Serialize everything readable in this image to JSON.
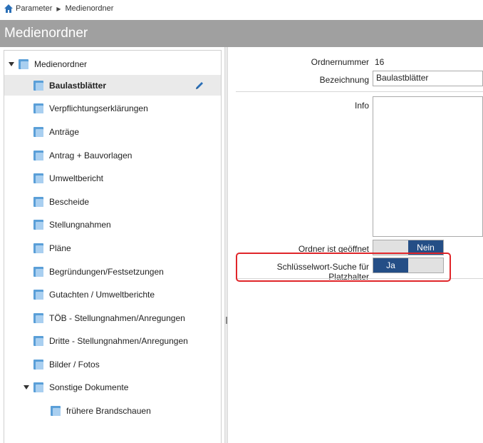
{
  "breadcrumb": {
    "items": [
      "Parameter",
      "Medienordner"
    ]
  },
  "title": "Medienordner",
  "tree": {
    "root": "Medienordner",
    "items": [
      "Baulastblätter",
      "Verpflichtungserklärungen",
      "Anträge",
      "Antrag + Bauvorlagen",
      "Umweltbericht",
      "Bescheide",
      "Stellungnahmen",
      "Pläne",
      "Begründungen/Festsetzungen",
      "Gutachten / Umweltberichte",
      "TÖB - Stellungnahmen/Anregungen",
      "Dritte - Stellungnahmen/Anregungen",
      "Bilder / Fotos",
      "Sonstige Dokumente"
    ],
    "subitems": [
      "frühere Brandschauen"
    ],
    "selected": "Baulastblätter"
  },
  "form": {
    "ordnernummer_label": "Ordnernummer",
    "ordnernummer_value": "16",
    "bezeichnung_label": "Bezeichnung",
    "bezeichnung_value": "Baulastblätter",
    "info_label": "Info",
    "geoeffnet_label": "Ordner ist geöffnet",
    "geoeffnet_value": "Nein",
    "schluessel_label": "Schlüsselwort-Suche für Platzhalter",
    "schluessel_value": "Ja"
  },
  "colors": {
    "accent": "#244e86",
    "titlebar": "#a0a0a0",
    "highlight": "#e0262a",
    "folder": "#5a9fd8"
  }
}
